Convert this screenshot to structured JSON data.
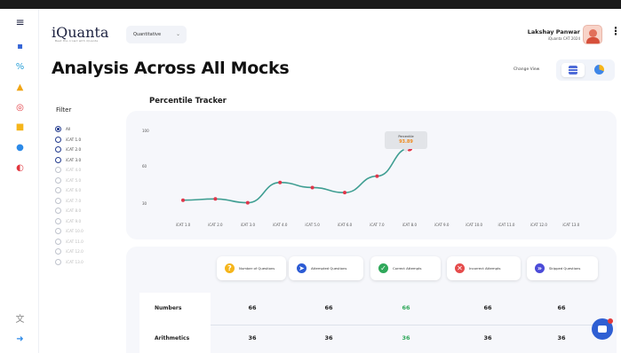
{
  "brand": {
    "name": "iQuanta",
    "tagline": "Beat the crowd with iQuanta"
  },
  "header": {
    "dropdown_value": "Quantitative",
    "user_name": "Lakshay Panwar",
    "user_sub": "iQuanta CAT 2024"
  },
  "page": {
    "title": "Analysis Across All Mocks",
    "change_view_label": "Change View"
  },
  "filter": {
    "title": "Filter",
    "options": [
      {
        "label": "All",
        "selected": true,
        "enabled": true
      },
      {
        "label": "iCAT 1.0",
        "selected": false,
        "enabled": true
      },
      {
        "label": "iCAT 2.0",
        "selected": false,
        "enabled": true
      },
      {
        "label": "iCAT 3.0",
        "selected": false,
        "enabled": true
      },
      {
        "label": "iCAT 4.0",
        "selected": false,
        "enabled": false
      },
      {
        "label": "iCAT 5.0",
        "selected": false,
        "enabled": false
      },
      {
        "label": "iCAT 6.0",
        "selected": false,
        "enabled": false
      },
      {
        "label": "iCAT 7.0",
        "selected": false,
        "enabled": false
      },
      {
        "label": "iCAT 8.0",
        "selected": false,
        "enabled": false
      },
      {
        "label": "iCAT 9.0",
        "selected": false,
        "enabled": false
      },
      {
        "label": "iCAT 10.0",
        "selected": false,
        "enabled": false
      },
      {
        "label": "iCAT 11.0",
        "selected": false,
        "enabled": false
      },
      {
        "label": "iCAT 12.0",
        "selected": false,
        "enabled": false
      },
      {
        "label": "iCAT 13.0",
        "selected": false,
        "enabled": false
      }
    ]
  },
  "chart_data": {
    "type": "line",
    "title": "Percentile Tracker",
    "categories": [
      "iCAT 1.0",
      "iCAT 2.0",
      "iCAT 3.0",
      "iCAT 4.0",
      "iCAT 5.0",
      "iCAT 6.0",
      "iCAT 7.0",
      "iCAT 8.0",
      "iCAT 9.0",
      "iCAT 10.0",
      "iCAT 11.0",
      "iCAT 12.0",
      "iCAT 13.0"
    ],
    "series": [
      {
        "values": [
          20,
          22,
          16,
          48,
          40,
          32,
          58,
          102,
          null,
          null,
          null,
          null,
          null
        ]
      }
    ],
    "yticks": [
      "100",
      "60",
      "30"
    ],
    "ylim": [
      0,
      140
    ],
    "grid": false,
    "line_color": "#3f9e92",
    "point_color": "#e0364a",
    "tooltip": {
      "title": "Percentile",
      "value": "93.89"
    }
  },
  "stats": {
    "chips": [
      {
        "label": "Number of Questions",
        "icon": "question-icon",
        "color": "#f5b51b"
      },
      {
        "label": "Attempted Questions",
        "icon": "cursor-icon",
        "color": "#2c5bd4"
      },
      {
        "label": "Correct Attempts",
        "icon": "check-icon",
        "color": "#2fa85a"
      },
      {
        "label": "Incorrect Attempts",
        "icon": "cross-icon",
        "color": "#e54b4b"
      },
      {
        "label": "Skipped Questions",
        "icon": "skip-icon",
        "color": "#4b4bd8"
      }
    ],
    "rows": [
      {
        "label": "Numbers",
        "values": [
          "66",
          "66",
          "66",
          "66",
          "66"
        ]
      },
      {
        "label": "Arithmetics",
        "values": [
          "36",
          "36",
          "36",
          "36",
          "36"
        ]
      }
    ]
  },
  "colors": {
    "accent": "#2f5fd3",
    "success": "#2fa85a",
    "danger": "#e54b4b"
  }
}
